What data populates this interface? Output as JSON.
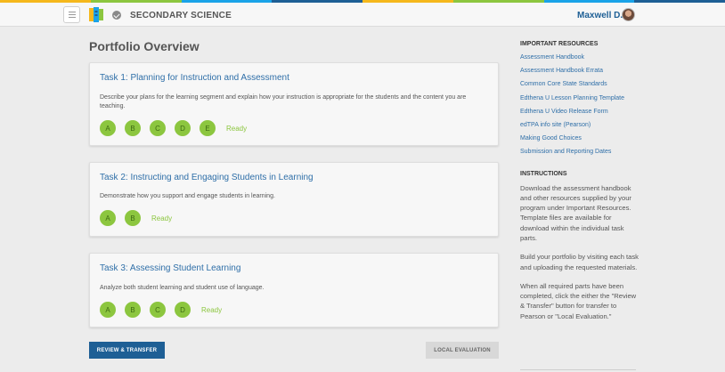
{
  "brand": {
    "stripe_colors": [
      "#f5b81c",
      "#8cc63f",
      "#1aa3e8",
      "#1e5f95",
      "#f5b81c",
      "#8cc63f",
      "#1aa3e8",
      "#1e5f95"
    ],
    "accent": "#1e5f95",
    "part_color": "#8cc63f",
    "link_color": "#2f6fa8"
  },
  "header": {
    "menu_icon": "hamburger-icon",
    "logo_icon": "book-logo-icon",
    "status_icon": "check-circle-icon",
    "title": "SECONDARY SCIENCE",
    "user_name": "Maxwell D."
  },
  "main": {
    "page_title": "Portfolio Overview",
    "tasks": [
      {
        "title": "Task 1: Planning for Instruction and Assessment",
        "description": "Describe your plans for the learning segment and explain how your instruction is appropriate for the students and the content you are teaching.",
        "parts": [
          "A",
          "B",
          "C",
          "D",
          "E"
        ],
        "status": "Ready"
      },
      {
        "title": "Task 2: Instructing and Engaging Students in Learning",
        "description": "Demonstrate how you support and engage students in learning.",
        "parts": [
          "A",
          "B"
        ],
        "status": "Ready"
      },
      {
        "title": "Task 3: Assessing Student Learning",
        "description": "Analyze both student learning and student use of language.",
        "parts": [
          "A",
          "B",
          "C",
          "D"
        ],
        "status": "Ready"
      }
    ],
    "review_button": "REVIEW & TRANSFER",
    "local_button": "LOCAL EVALUATION"
  },
  "sidebar": {
    "resources_heading": "IMPORTANT RESOURCES",
    "resources": [
      "Assessment Handbook",
      "Assessment Handbook Errata",
      "Common Core State Standards",
      "Edthena U Lesson Planning Template",
      "Edthena U Video Release Form",
      "edTPA info site (Pearson)",
      "Making Good Choices",
      "Submission and Reporting Dates"
    ],
    "instructions_heading": "INSTRUCTIONS",
    "instructions": [
      "Download the assessment handbook and other resources supplied by your program under Important Resources. Template files are available for download within the individual task parts.",
      "Build your portfolio by visiting each task and uploading the requested materials.",
      "When all required parts have been completed, click the either the \"Review & Transfer\" button for transfer to Pearson or \"Local Evaluation.\""
    ]
  }
}
